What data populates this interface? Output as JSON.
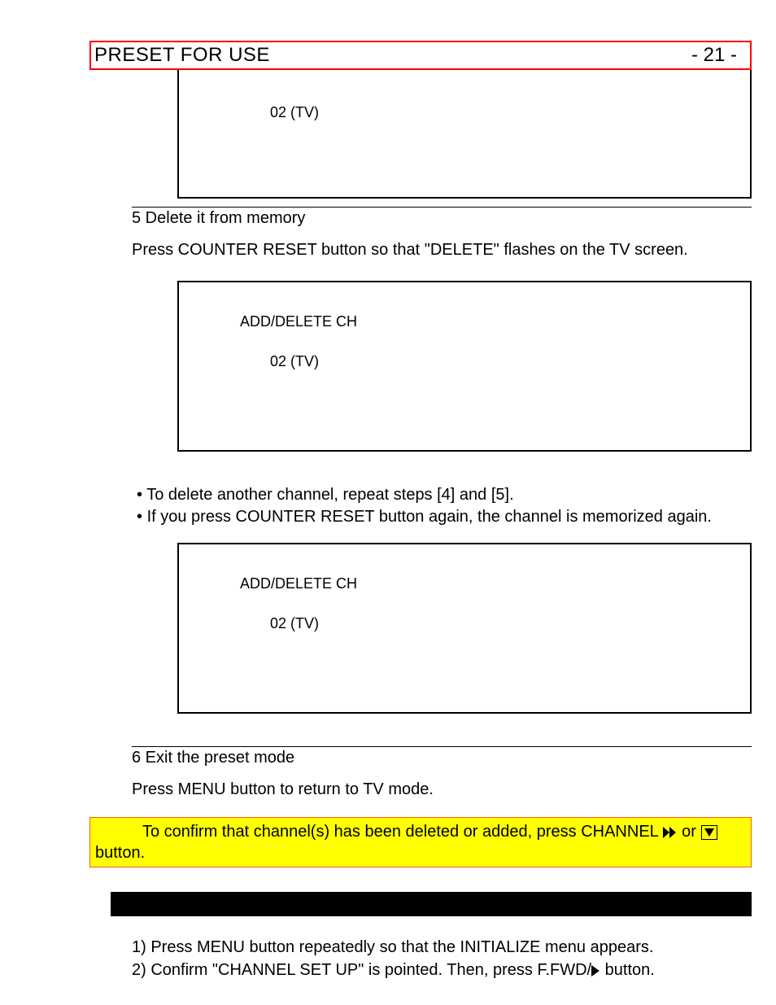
{
  "header": {
    "title": "PRESET FOR USE",
    "page": "- 21 -"
  },
  "tvbox1": {
    "value": "02  (TV)"
  },
  "step5": {
    "title": "5 Delete it from memory",
    "body": "Press COUNTER RESET button so that \"DELETE\" flashes on the TV screen."
  },
  "tvbox2": {
    "title": "ADD/DELETE CH",
    "value": "02  (TV)"
  },
  "bullets": {
    "b1": "To delete another channel, repeat steps [4] and [5].",
    "b2": "If you press COUNTER RESET button again, the channel is memorized again."
  },
  "tvbox3": {
    "title": "ADD/DELETE CH",
    "value": "02  (TV)"
  },
  "step6": {
    "title": "6 Exit the preset mode",
    "body": "Press MENU button to return to TV mode."
  },
  "confirm": {
    "pre": "To confirm that channel(s) has been deleted or added, press CHANNEL ",
    "mid": " or ",
    "post": " button."
  },
  "blackbar": "",
  "numbered": {
    "n1": "1) Press MENU button repeatedly so that the INITIALIZE menu appears.",
    "n2_pre": "2) Confirm \"CHANNEL SET UP\" is pointed. Then, press F.FWD/",
    "n2_post": " button."
  }
}
